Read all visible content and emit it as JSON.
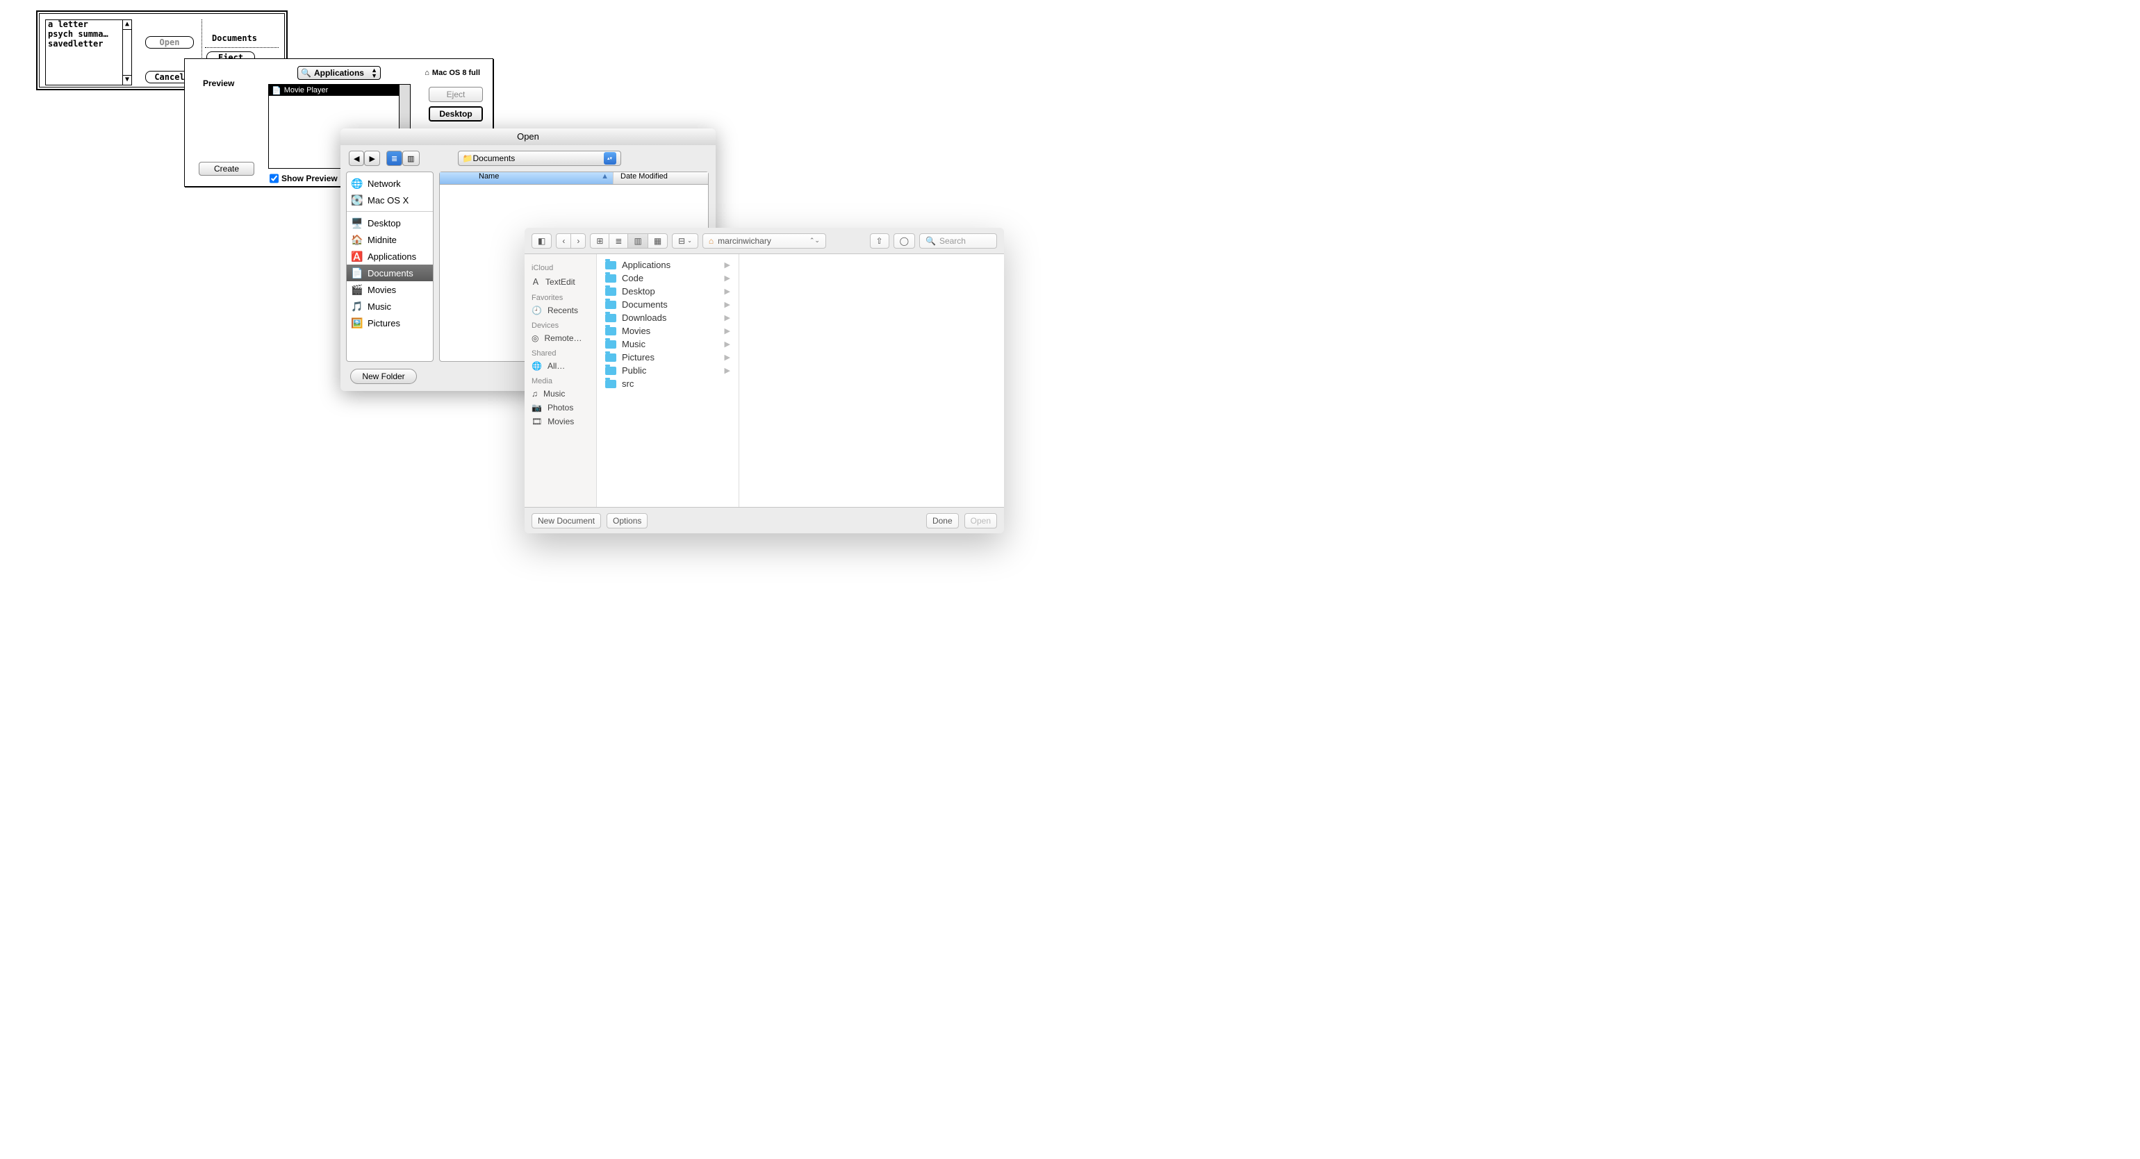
{
  "d1": {
    "items": [
      "a letter",
      "psych summa…",
      "savedletter"
    ],
    "open": "Open",
    "eject": "Eject",
    "cancel": "Cancel",
    "label": "Documents"
  },
  "d2": {
    "preview": "Preview",
    "create": "Create",
    "popup": "Applications",
    "fileRow": "Movie Player",
    "disk": "Mac OS 8 full",
    "eject": "Eject",
    "desktop": "Desktop",
    "showPreview": "Show Preview"
  },
  "d3": {
    "title": "Open",
    "popup": "Documents",
    "sidebarTop": [
      "Network",
      "Mac OS X"
    ],
    "sidebarMid": [
      "Desktop",
      "Midnite",
      "Applications",
      "Documents",
      "Movies",
      "Music",
      "Pictures"
    ],
    "selected": "Documents",
    "colName": "Name",
    "colDate": "Date Modified",
    "newFolder": "New Folder"
  },
  "d4": {
    "popup": "marcinwichary",
    "search": "Search",
    "sidebar": {
      "iCloud": {
        "head": "iCloud",
        "items": [
          "TextEdit"
        ]
      },
      "favorites": {
        "head": "Favorites",
        "items": [
          "Recents"
        ]
      },
      "devices": {
        "head": "Devices",
        "items": [
          "Remote…"
        ]
      },
      "shared": {
        "head": "Shared",
        "items": [
          "All…"
        ]
      },
      "media": {
        "head": "Media",
        "items": [
          "Music",
          "Photos",
          "Movies"
        ]
      }
    },
    "files": [
      "Applications",
      "Code",
      "Desktop",
      "Documents",
      "Downloads",
      "Movies",
      "Music",
      "Pictures",
      "Public",
      "src"
    ],
    "newDoc": "New Document",
    "options": "Options",
    "done": "Done",
    "open": "Open"
  }
}
